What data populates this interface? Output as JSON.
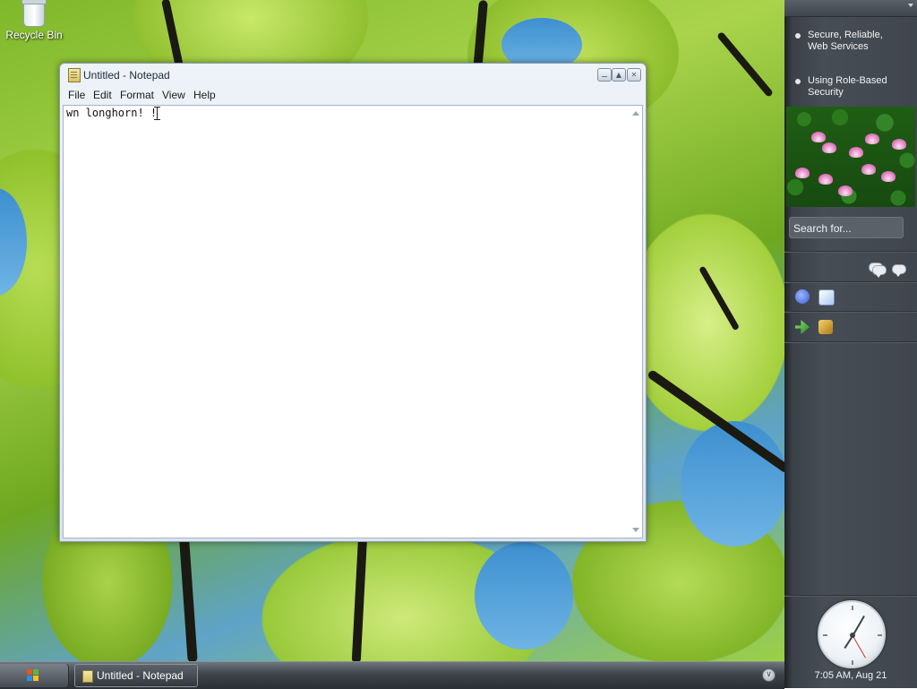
{
  "desktop": {
    "icons": [
      {
        "label": "Recycle Bin",
        "icon": "recycle-bin-icon"
      }
    ]
  },
  "notepad": {
    "title": "Untitled - Notepad",
    "icon": "notepad-icon",
    "caption_buttons": [
      "minimize",
      "maximize",
      "close"
    ],
    "menu": [
      "File",
      "Edit",
      "Format",
      "View",
      "Help"
    ],
    "content": "wn longhorn! !"
  },
  "sidebar": {
    "news": [
      {
        "line1": "Secure, Reliable,",
        "line2": "Web Services"
      },
      {
        "line1": "Using Role-Based",
        "line2": "Security"
      }
    ],
    "search_placeholder": "Search for...",
    "clock_label": "7:05 AM, Aug 21"
  },
  "taskbar": {
    "start_icon": "windows-logo-icon",
    "tasks": [
      {
        "label": "Untitled - Notepad",
        "icon": "notepad-icon"
      }
    ],
    "tray_icon": "chevron-down-icon"
  },
  "colors": {
    "sidebar_bg": "#474d55",
    "taskbar_bg": "#3e444b",
    "wallpaper_green": "#8fc12c"
  }
}
